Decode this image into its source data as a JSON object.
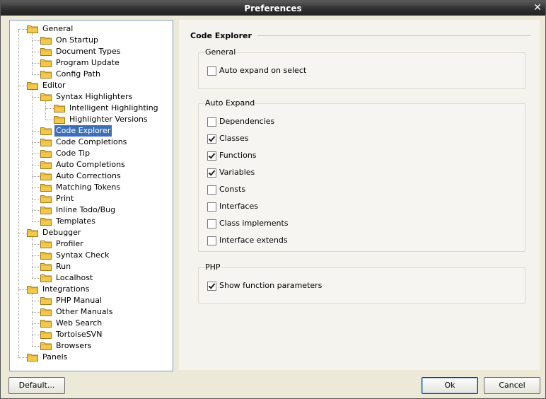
{
  "window": {
    "title": "Preferences"
  },
  "tree": [
    {
      "label": "General",
      "level": 0,
      "open": true
    },
    {
      "label": "On Startup",
      "level": 1
    },
    {
      "label": "Document Types",
      "level": 1
    },
    {
      "label": "Program Update",
      "level": 1
    },
    {
      "label": "Config Path",
      "level": 1
    },
    {
      "label": "Editor",
      "level": 0,
      "open": true
    },
    {
      "label": "Syntax Highlighters",
      "level": 1,
      "open": true
    },
    {
      "label": "Intelligent Highlighting",
      "level": 2
    },
    {
      "label": "Highlighter Versions",
      "level": 2
    },
    {
      "label": "Code Explorer",
      "level": 1,
      "selected": true
    },
    {
      "label": "Code Completions",
      "level": 1
    },
    {
      "label": "Code Tip",
      "level": 1
    },
    {
      "label": "Auto Completions",
      "level": 1
    },
    {
      "label": "Auto Corrections",
      "level": 1
    },
    {
      "label": "Matching Tokens",
      "level": 1
    },
    {
      "label": "Print",
      "level": 1
    },
    {
      "label": "Inline Todo/Bug",
      "level": 1
    },
    {
      "label": "Templates",
      "level": 1
    },
    {
      "label": "Debugger",
      "level": 0,
      "open": true
    },
    {
      "label": "Profiler",
      "level": 1
    },
    {
      "label": "Syntax Check",
      "level": 1
    },
    {
      "label": "Run",
      "level": 1
    },
    {
      "label": "Localhost",
      "level": 1
    },
    {
      "label": "Integrations",
      "level": 0,
      "open": true
    },
    {
      "label": "PHP Manual",
      "level": 1
    },
    {
      "label": "Other Manuals",
      "level": 1
    },
    {
      "label": "Web Search",
      "level": 1
    },
    {
      "label": "TortoiseSVN",
      "level": 1
    },
    {
      "label": "Browsers",
      "level": 1
    },
    {
      "label": "Panels",
      "level": 0
    }
  ],
  "panel": {
    "heading": "Code Explorer",
    "groups": [
      {
        "title": "General",
        "options": [
          {
            "label": "Auto expand on select",
            "checked": false
          }
        ]
      },
      {
        "title": "Auto Expand",
        "options": [
          {
            "label": "Dependencies",
            "checked": false
          },
          {
            "label": "Classes",
            "checked": true
          },
          {
            "label": "Functions",
            "checked": true
          },
          {
            "label": "Variables",
            "checked": true
          },
          {
            "label": "Consts",
            "checked": false
          },
          {
            "label": "Interfaces",
            "checked": false
          },
          {
            "label": "Class implements",
            "checked": false
          },
          {
            "label": "Interface extends",
            "checked": false
          }
        ]
      },
      {
        "title": "PHP",
        "options": [
          {
            "label": "Show function parameters",
            "checked": true
          }
        ]
      }
    ]
  },
  "buttons": {
    "default": "Default...",
    "ok": "Ok",
    "cancel": "Cancel"
  },
  "colors": {
    "selection": "#3d6fb6",
    "folder": "#f2c94c"
  }
}
